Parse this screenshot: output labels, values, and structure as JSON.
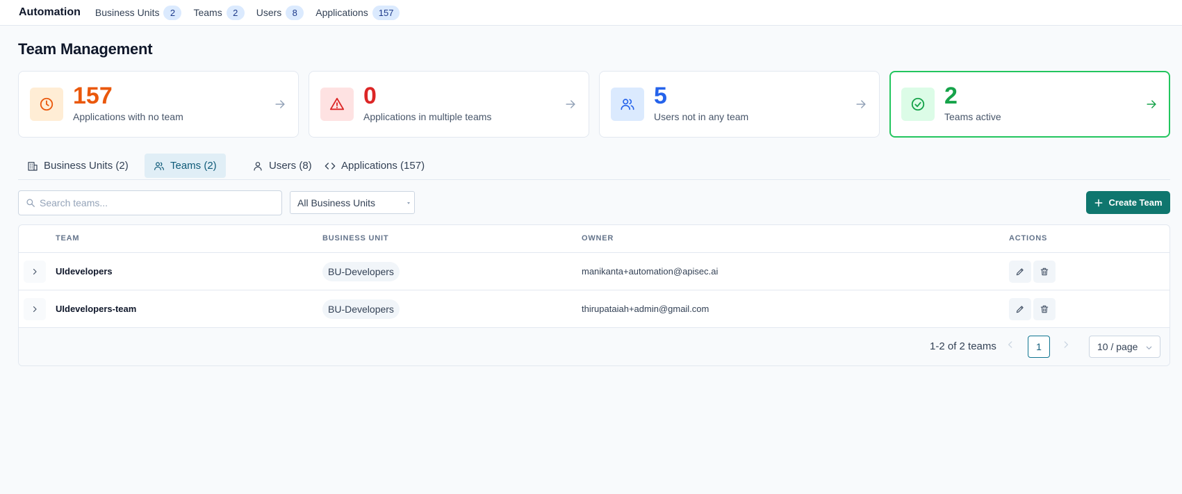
{
  "topbar": {
    "brand": "Automation",
    "nav": [
      {
        "label": "Business Units",
        "count": "2"
      },
      {
        "label": "Teams",
        "count": "2"
      },
      {
        "label": "Users",
        "count": "8"
      },
      {
        "label": "Applications",
        "count": "157"
      }
    ]
  },
  "page": {
    "title": "Team Management"
  },
  "stats": [
    {
      "value": "157",
      "label": "Applications with no team",
      "color": "#ea580c",
      "icon": "clock-icon"
    },
    {
      "value": "0",
      "label": "Applications in multiple teams",
      "color": "#dc2626",
      "icon": "warning-icon"
    },
    {
      "value": "5",
      "label": "Users not in any team",
      "color": "#2563eb",
      "icon": "users-icon"
    },
    {
      "value": "2",
      "label": "Teams active",
      "color": "#16a34a",
      "icon": "check-circle-icon"
    }
  ],
  "tabs": [
    {
      "label": "Business Units (2)",
      "icon": "building-icon"
    },
    {
      "label": "Teams (2)",
      "icon": "users-icon"
    },
    {
      "label": "Users (8)",
      "icon": "user-icon"
    },
    {
      "label": "Applications (157)",
      "icon": "code-icon"
    }
  ],
  "filters": {
    "search_placeholder": "Search teams...",
    "business_unit_selected": "All Business Units",
    "create_label": "Create Team"
  },
  "table": {
    "headers": {
      "team": "TEAM",
      "business_unit": "BUSINESS UNIT",
      "owner": "OWNER",
      "actions": "ACTIONS"
    },
    "rows": [
      {
        "team": "UIdevelopers",
        "business_unit": "BU-Developers",
        "owner": "manikanta+automation@apisec.ai"
      },
      {
        "team": "UIdevelopers-team",
        "business_unit": "BU-Developers",
        "owner": "thirupataiah+admin@gmail.com"
      }
    ]
  },
  "pagination": {
    "range": "1-2 of 2 teams",
    "current_page": "1",
    "per_page": "10 / page"
  },
  "colors": {
    "accent": "#0f766e",
    "active_border": "#22c55e"
  }
}
